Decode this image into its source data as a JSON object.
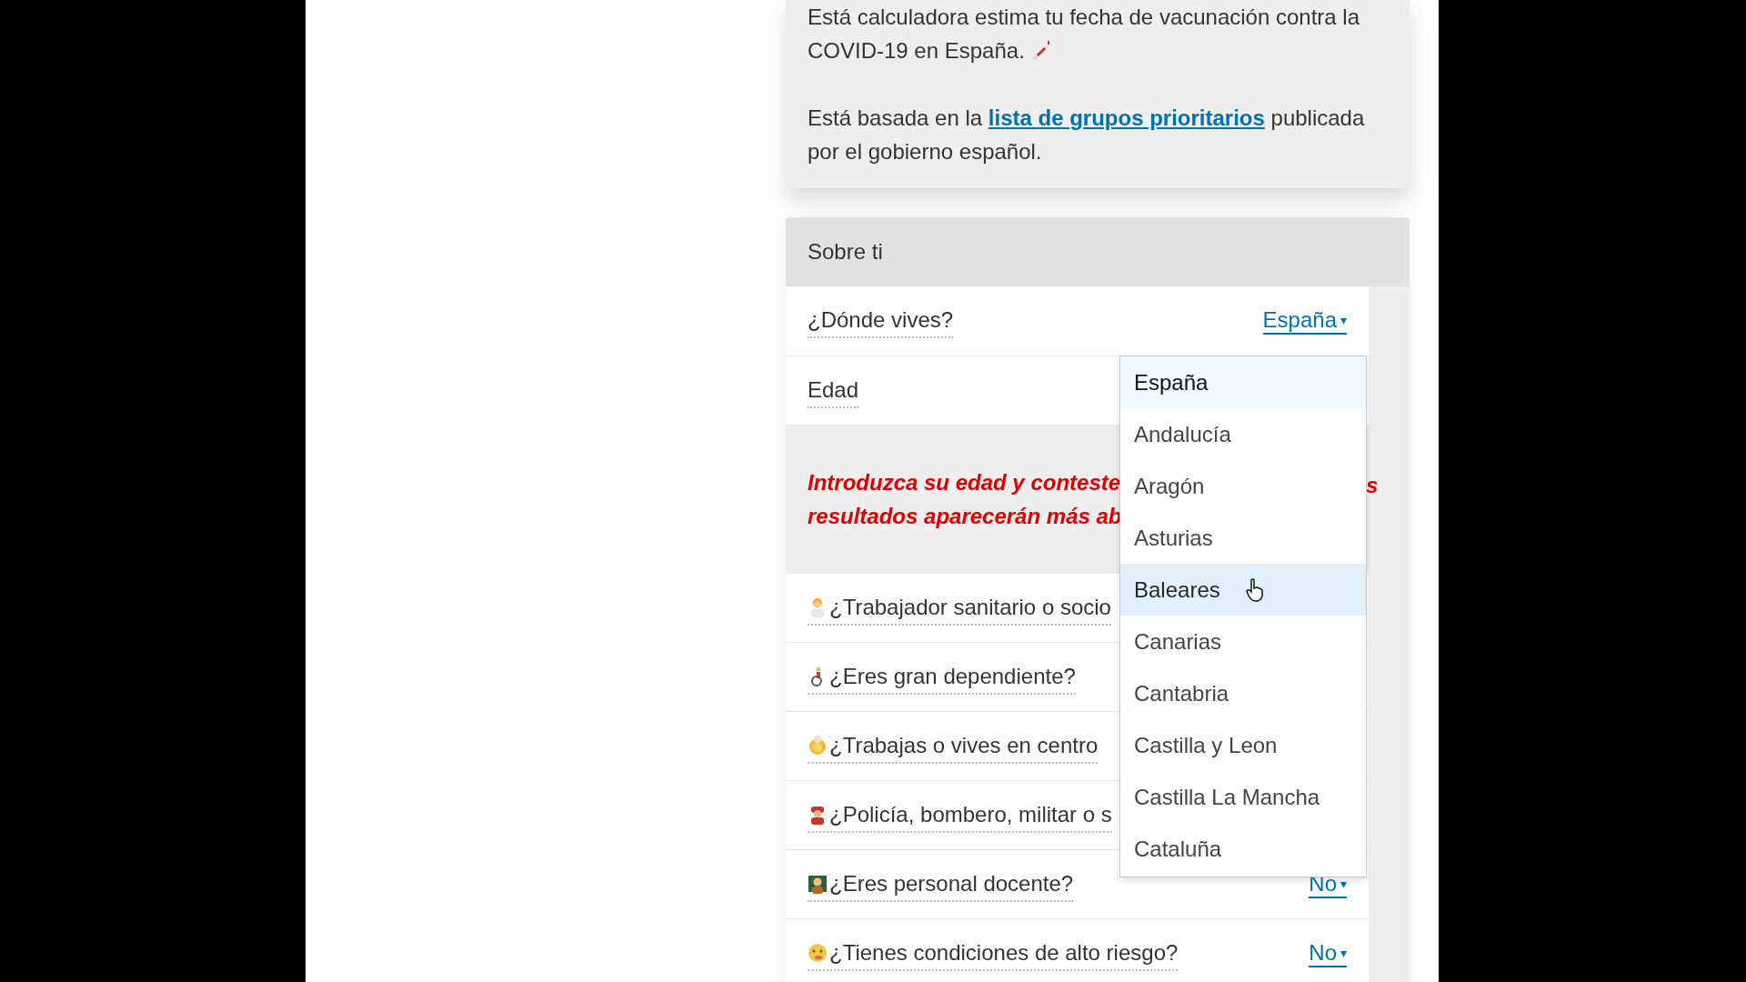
{
  "intro": {
    "line1": "Está calculadora estima tu fecha de vacunación contra",
    "line2": "la COVID-19 en España.",
    "p2_before": "Está basada en la",
    "link": "lista de grupos prioritarios",
    "p2_after": "publicada por el gobierno español."
  },
  "section": {
    "title": "Sobre ti"
  },
  "location": {
    "label": "¿Dónde vives?",
    "value": "España",
    "caret": "▾"
  },
  "age": {
    "label": "Edad"
  },
  "warning": {
    "line1": "Introduzca su edad y conteste",
    "line1_end": "s",
    "line2": "resultados aparecerán más ab"
  },
  "questions": [
    {
      "kind": "health",
      "label": "¿Trabajador sanitario o socio"
    },
    {
      "kind": "wheelchair",
      "label": "¿Eres gran dependiente?"
    },
    {
      "kind": "elder",
      "label": "¿Trabajas o vives en centro"
    },
    {
      "kind": "firefighter",
      "label": "¿Policía, bombero, militar o s"
    },
    {
      "kind": "teacher",
      "label": "¿Eres personal docente?",
      "answer": "No",
      "caret": "▾"
    },
    {
      "kind": "sick",
      "label": "¿Tienes condiciones de alto riesgo?",
      "answer": "No",
      "caret": "▾"
    }
  ],
  "dropdown": {
    "options": [
      {
        "label": "España",
        "selected": true,
        "hovered": false
      },
      {
        "label": "Andalucía",
        "selected": false,
        "hovered": false
      },
      {
        "label": "Aragón",
        "selected": false,
        "hovered": false
      },
      {
        "label": "Asturias",
        "selected": false,
        "hovered": false
      },
      {
        "label": "Baleares",
        "selected": false,
        "hovered": true
      },
      {
        "label": "Canarias",
        "selected": false,
        "hovered": false
      },
      {
        "label": "Cantabria",
        "selected": false,
        "hovered": false
      },
      {
        "label": "Castilla y Leon",
        "selected": false,
        "hovered": false
      },
      {
        "label": "Castilla La Mancha",
        "selected": false,
        "hovered": false
      },
      {
        "label": "Cataluña",
        "selected": false,
        "hovered": false
      }
    ]
  }
}
